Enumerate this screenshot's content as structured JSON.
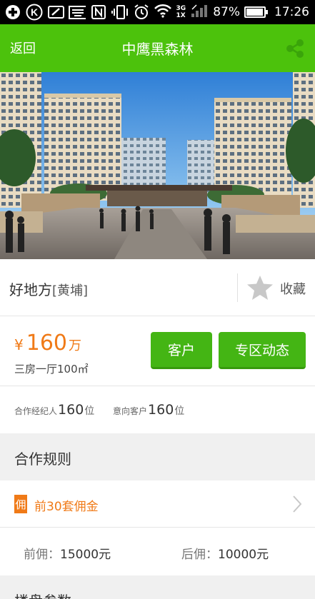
{
  "status_bar": {
    "battery_percent_text": "87%",
    "battery_level": 0.87,
    "time": "17:26",
    "net_top": "3G",
    "net_bottom": "1X",
    "icons": [
      "plus-icon",
      "k-icon",
      "edit-icon",
      "keyboard-icon",
      "nfc-icon",
      "vibrate-icon",
      "alarm-icon",
      "wifi-icon",
      "signal-icon",
      "battery-icon"
    ]
  },
  "header": {
    "back_label": "返回",
    "title": "中鹰黑森林",
    "accent_color": "#4cc20c"
  },
  "property": {
    "name": "好地方",
    "district": "[黄埔]",
    "favorite_label": "收藏",
    "price_currency": "¥",
    "price_value": "160",
    "price_unit": "万",
    "layout": "三房一厅100㎡",
    "price_color": "#f07a17"
  },
  "actions": {
    "client_label": "客户",
    "news_label": "专区动态",
    "button_color": "#44b514"
  },
  "stats": {
    "agents_label": "合作经纪人",
    "agents_value": "160",
    "agents_unit": "位",
    "clients_label": "意向客户",
    "clients_value": "160",
    "clients_unit": "位"
  },
  "cooperation": {
    "title": "合作规则",
    "badge": "佣",
    "commission_text": "前30套佣金",
    "before_label": "前佣：",
    "before_value": "15000元",
    "after_label": "后佣：",
    "after_value": "10000元"
  },
  "params": {
    "title": "楼盘参数"
  }
}
